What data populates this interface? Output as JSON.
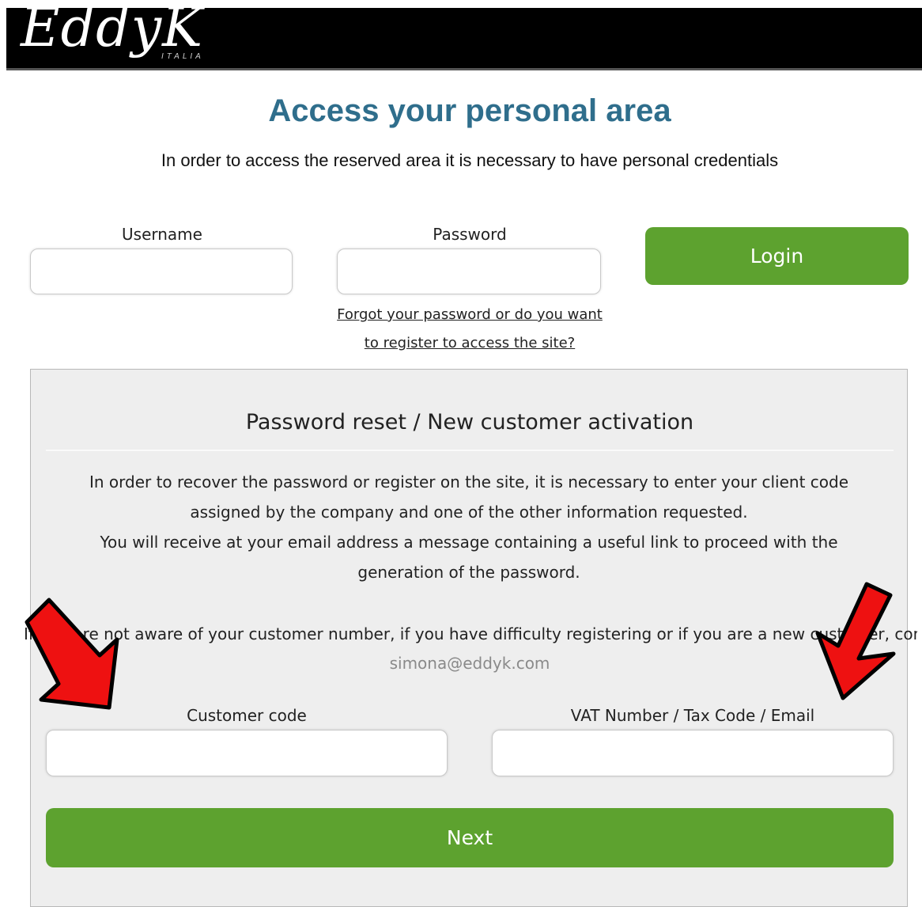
{
  "header": {
    "logo_main": "EddyK",
    "logo_sub": "ITALIA"
  },
  "login": {
    "title": "Access your personal area",
    "intro": "In order to access the reserved area it is necessary to have personal credentials",
    "username_label": "Username",
    "username_value": "",
    "password_label": "Password",
    "password_value": "",
    "login_button": "Login",
    "forgot_link": "Forgot your password or do you want to register to access the site?"
  },
  "reset_panel": {
    "title": "Password reset / New customer activation",
    "paragraph1": "In order to recover the password or register on the site, it is necessary to enter your client code assigned by the company and one of the other information requested.",
    "paragraph2": "You will receive at your email address a message containing a useful link to proceed with the generation of the password.",
    "contact_text": "If you are not aware of your customer number, if you have difficulty registering or if you are a new customer, contact",
    "contact_email": "simona@eddyk.com",
    "customer_code_label": "Customer code",
    "customer_code_value": "",
    "vat_label": "VAT Number / Tax Code / Email",
    "vat_value": "",
    "next_button": "Next"
  },
  "colors": {
    "accent_green": "#5da22f",
    "title_blue": "#2f6e8c",
    "arrow_red": "#ee1111",
    "panel_bg": "#eeeeee"
  }
}
